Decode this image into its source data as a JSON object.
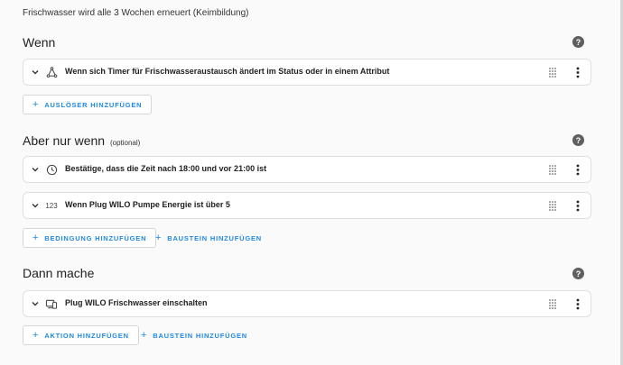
{
  "description": "Frischwasser wird alle 3 Wochen erneuert (Keimbildung)",
  "help_glyph": "?",
  "sections": {
    "triggers": {
      "title": "Wenn",
      "items": [
        {
          "label": "Wenn sich Timer für Frischwasseraustausch ändert im Status oder in einem Attribut",
          "icon": "state-node-icon"
        }
      ],
      "buttons": [
        {
          "label": "AUSLÖSER HINZUFÜGEN"
        }
      ]
    },
    "conditions": {
      "title": "Aber nur wenn",
      "optional": "(optional)",
      "items": [
        {
          "label": "Bestätige, dass die Zeit nach 18:00 und vor 21:00 ist",
          "icon": "clock-icon"
        },
        {
          "label": "Wenn Plug WILO Pumpe Energie ist über 5",
          "icon": "numeric-icon",
          "icon_text": "123"
        }
      ],
      "buttons": [
        {
          "label": "BEDINGUNG HINZUFÜGEN"
        },
        {
          "label": "BAUSTEIN HINZUFÜGEN"
        }
      ]
    },
    "actions": {
      "title": "Dann mache",
      "items": [
        {
          "label": "Plug WILO Frischwasser einschalten",
          "icon": "device-icon"
        }
      ],
      "buttons": [
        {
          "label": "AKTION HINZUFÜGEN"
        },
        {
          "label": "BAUSTEIN HINZUFÜGEN"
        }
      ]
    }
  },
  "colors": {
    "accent": "#1e88e5",
    "help": "#5f5f5f",
    "background": "#fafafa"
  }
}
